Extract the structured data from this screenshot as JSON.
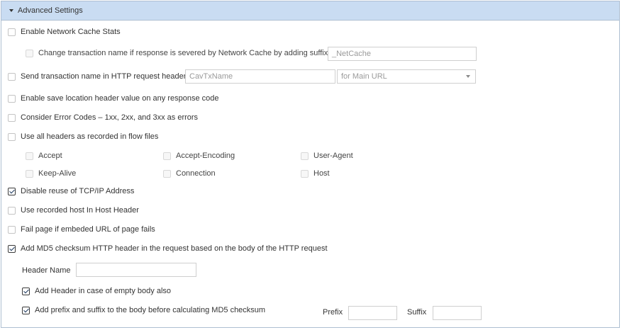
{
  "header": {
    "title": "Advanced Settings"
  },
  "network_cache": {
    "label": "Enable Network Cache Stats",
    "change_name_label": "Change transaction name if response is severed by Network Cache by adding suffix",
    "suffix_placeholder": "_NetCache"
  },
  "send_tx": {
    "label": "Send transaction name in HTTP request header",
    "header_placeholder": "CavTxName",
    "url_select": "for Main URL"
  },
  "save_location": {
    "label": "Enable save location header value on any response code"
  },
  "error_codes": {
    "label": "Consider Error Codes – 1xx, 2xx, and 3xx as errors"
  },
  "all_headers": {
    "label": "Use all headers as recorded in flow files",
    "items": [
      "Accept",
      "Accept-Encoding",
      "User-Agent",
      "Keep-Alive",
      "Connection",
      "Host"
    ]
  },
  "tcp_reuse": {
    "label": "Disable reuse of TCP/IP Address",
    "checked": true
  },
  "host_header": {
    "label": "Use recorded host In Host Header"
  },
  "fail_page": {
    "label": "Fail page if embeded URL of page fails"
  },
  "md5": {
    "label": "Add MD5 checksum HTTP header in the request based on the body of the HTTP request",
    "checked": true,
    "header_name_label": "Header Name",
    "header_name_value": "",
    "empty_body_label": "Add Header in case of empty body also",
    "prefix_suffix_label": "Add prefix and suffix to the body before calculating MD5 checksum",
    "prefix_label": "Prefix",
    "suffix_label": "Suffix",
    "prefix_value": "",
    "suffix_value": ""
  },
  "colors": {
    "header_bg": "#c9dcf2",
    "border": "#aebfd2",
    "check": "#1f3a5f"
  }
}
